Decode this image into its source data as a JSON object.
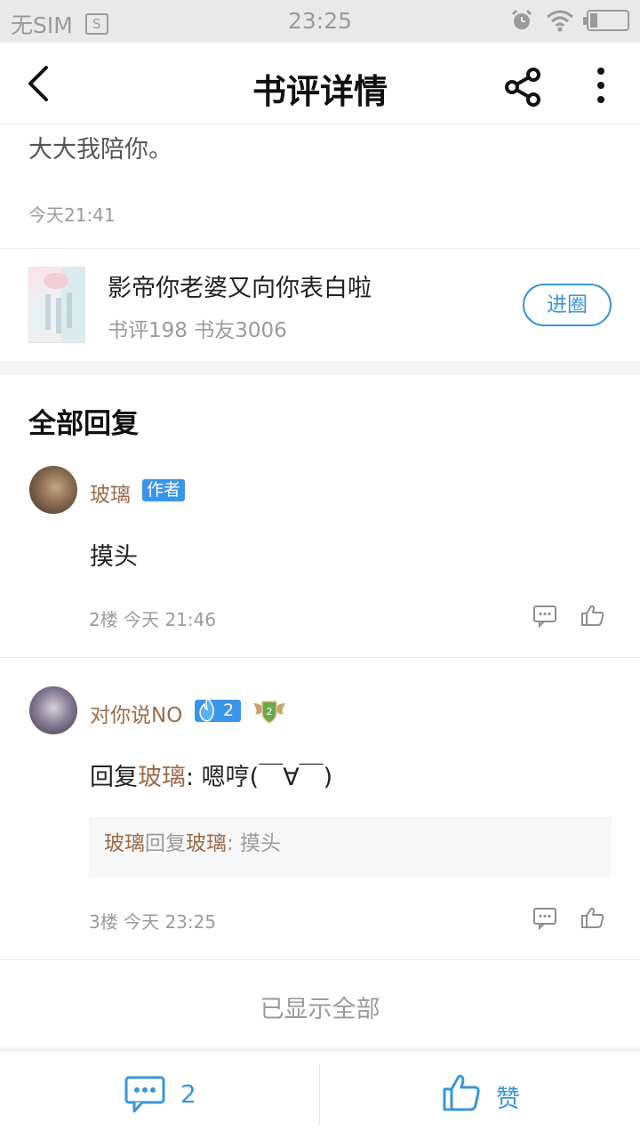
{
  "status_bar": {
    "carrier": "无SIM",
    "sim_glyph": "S",
    "time": "23:25"
  },
  "header": {
    "title": "书评详情"
  },
  "review": {
    "text_tail": "大大我陪你。",
    "time": "今天21:41"
  },
  "book": {
    "title": "影帝你老婆又向你表白啦",
    "meta": "书评198 书友3006",
    "join_label": "进圈"
  },
  "replies_section": {
    "title": "全部回复",
    "replies": [
      {
        "username": "玻璃",
        "badge": "作者",
        "body": "摸头",
        "meta": "2楼 今天 21:46"
      },
      {
        "username": "对你说NO",
        "fire_level": "2",
        "wing_level": "2",
        "reply_prefix": "回复",
        "reply_target": "玻璃",
        "body": ": 嗯哼(￣∀￣)",
        "quote": {
          "author": "玻璃",
          "verb": "回复",
          "target": "玻璃",
          "text": ": 摸头"
        },
        "meta": "3楼 今天 23:25"
      }
    ],
    "end_label": "已显示全部"
  },
  "bottom_bar": {
    "comment_count": "2",
    "like_label": "赞"
  },
  "colors": {
    "accent": "#3a95d8",
    "username": "#9b6d4b",
    "muted": "#9b9b9b"
  }
}
